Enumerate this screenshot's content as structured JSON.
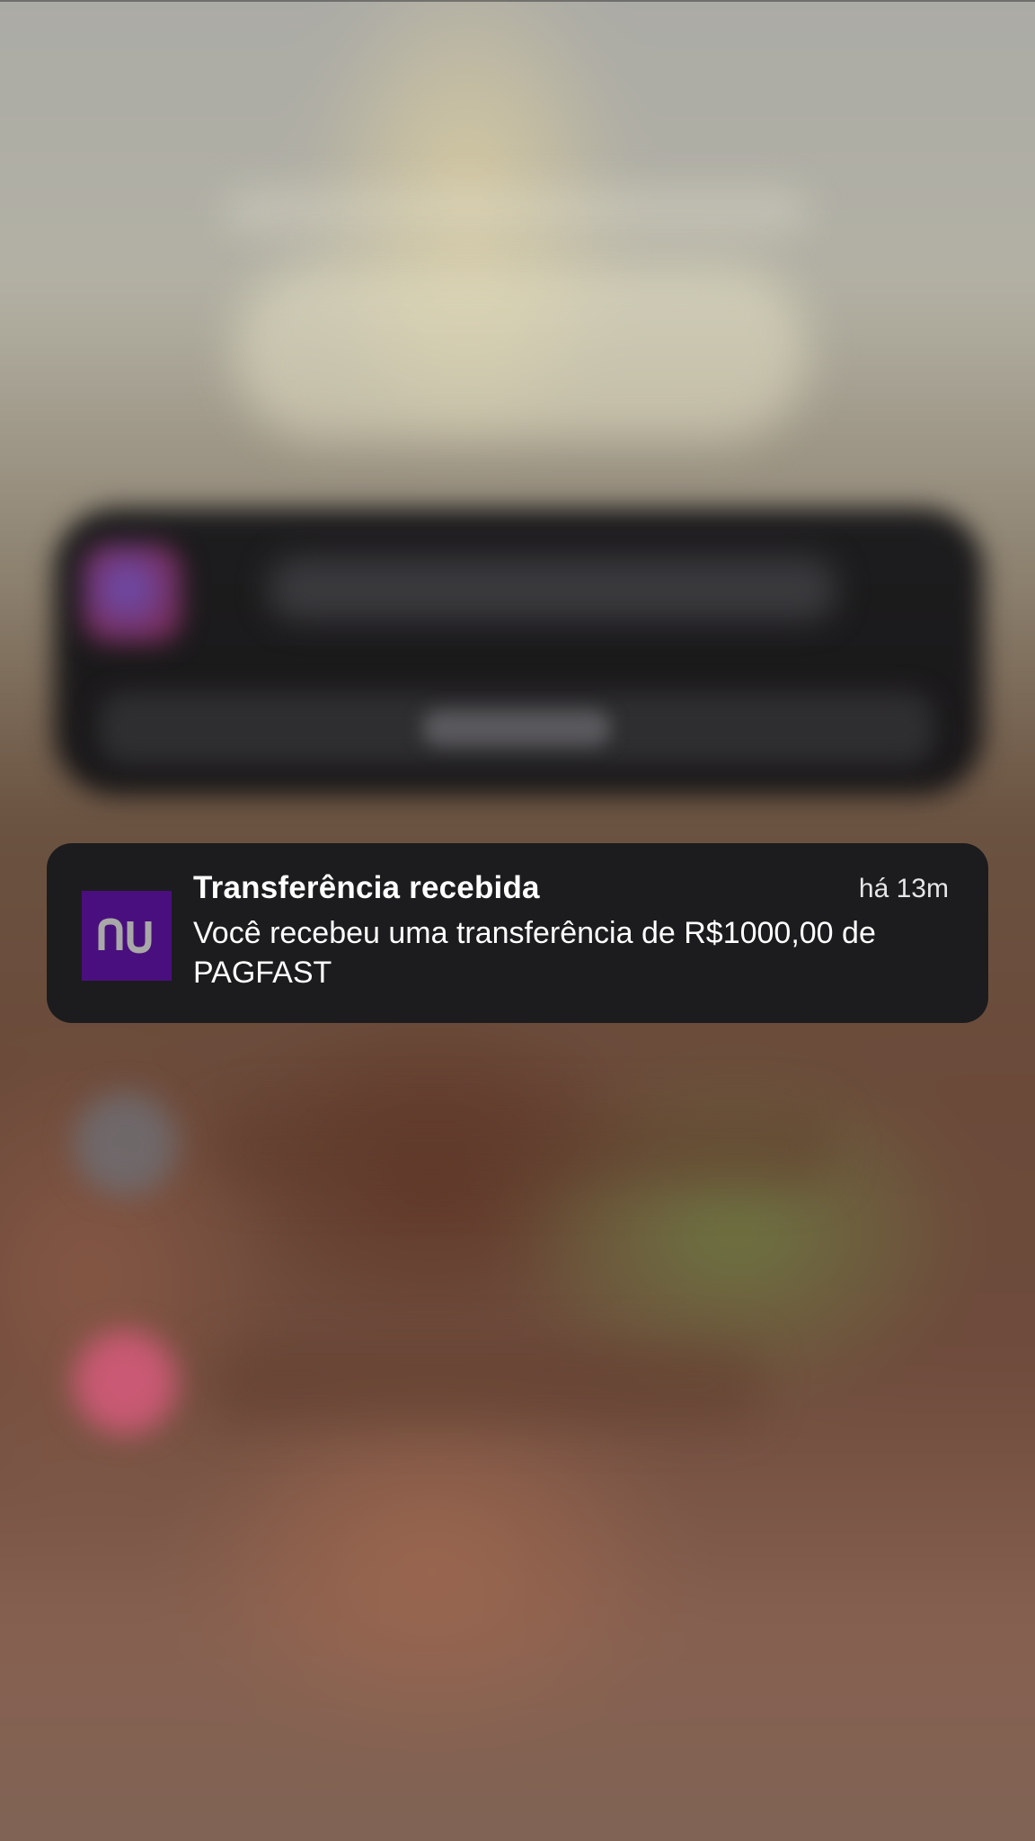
{
  "notification": {
    "app_icon": "nubank-logo-icon",
    "app_icon_text": "nu",
    "title": "Transferência recebida",
    "time": "há 13m",
    "body": "Você recebeu uma transferência de R$1000,00 de PAGFAST"
  },
  "colors": {
    "notification_background": "#1c1c1e",
    "app_icon_background": "#4a0f7e",
    "app_icon_foreground": "#a8a8a8"
  }
}
